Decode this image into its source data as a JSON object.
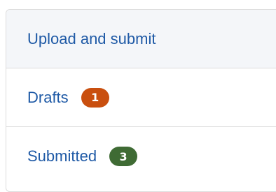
{
  "panel": {
    "header": {
      "label": "Upload and submit"
    },
    "items": [
      {
        "label": "Drafts",
        "count": "1",
        "badge_color": "#c94f0f"
      },
      {
        "label": "Submitted",
        "count": "3",
        "badge_color": "#3f6b34"
      }
    ]
  }
}
